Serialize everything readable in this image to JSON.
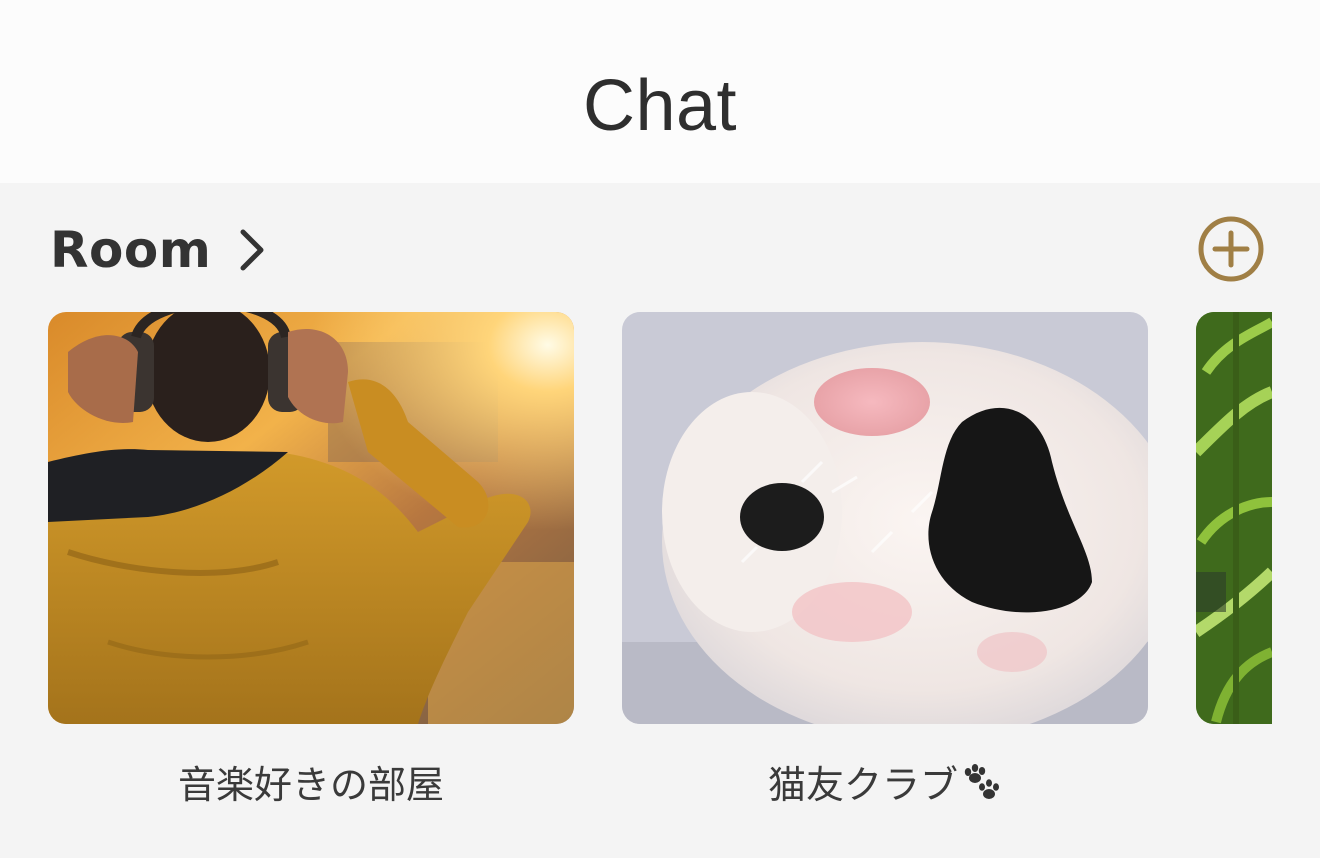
{
  "header": {
    "title": "Chat"
  },
  "rooms_section": {
    "title": "Room",
    "chevron_icon": "chevron-right-icon",
    "add_icon": "plus-circle-icon",
    "accent_color": "#a07f45"
  },
  "rooms": [
    {
      "name": "音楽好きの部屋",
      "image": "person-with-headphones-sunset"
    },
    {
      "name": "猫友クラブ",
      "image": "cat-paw-closeup",
      "trailing_icon": "paw-prints-icon"
    },
    {
      "name": "",
      "image": "green-plant-leaves"
    }
  ]
}
